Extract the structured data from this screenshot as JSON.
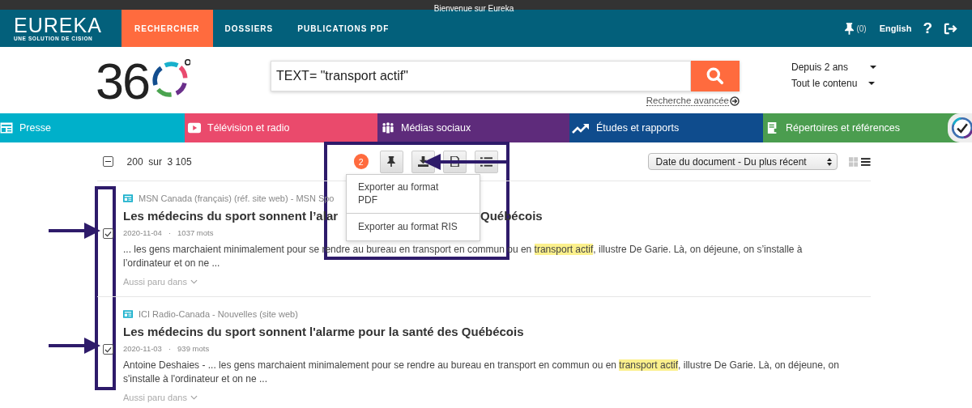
{
  "welcome_bar": {
    "title": "Bienvenue sur Eureka"
  },
  "nav": {
    "logo": "EUREKA",
    "logo_tagline": "UNE SOLUTION DE CISION",
    "tabs": [
      {
        "label": "RECHERCHER",
        "selected": true
      },
      {
        "label": "DOSSIERS",
        "selected": false
      },
      {
        "label": "PUBLICATIONS PDF",
        "selected": false
      }
    ],
    "pinned_count": "(0)",
    "language": "English",
    "help": "?"
  },
  "search": {
    "logo_text": "36",
    "query": "TEXT= \"transport actif\"",
    "advanced_link": "Recherche avancée",
    "filters": [
      {
        "label": "Depuis 2 ans"
      },
      {
        "label": "Tout le contenu"
      }
    ]
  },
  "categories": [
    {
      "label": "Presse",
      "color": "#00b0ca"
    },
    {
      "label": "Télévision et radio",
      "color": "#ea4a6c"
    },
    {
      "label": "Médias sociaux",
      "color": "#5e2b7b"
    },
    {
      "label": "Études et rapports",
      "color": "#0f4c8d"
    },
    {
      "label": "Répertoires et références",
      "color": "#4b9d4f"
    }
  ],
  "results_toolbar": {
    "partially_selected": true,
    "count": "200  sur  3 105",
    "selected_count": "2",
    "sort": "Date du document - Du plus récent"
  },
  "export_menu": {
    "items": [
      "Exporter au format PDF",
      "Exporter au format RIS"
    ]
  },
  "results": [
    {
      "checked": true,
      "source": "MSN Canada (français) (réf. site web) - MSN Spo",
      "title_parts": [
        "Les médecins du sport sonnent l’alar",
        "Québécois"
      ],
      "meta": [
        "2020-11-04",
        "·",
        "1037 mots"
      ],
      "snippet": [
        {
          "text": "... les gens marchaient minimalement pour se rendre au bureau en transport en commun ou en ",
          "highlight": false
        },
        {
          "text": "transport ",
          "highlight": true
        },
        {
          "text": "actif",
          "highlight": true
        },
        {
          "text": ", illustre De Garie. Là, on déjeune, on s’installe à l’ordinateur et on ne ...",
          "highlight": false
        }
      ],
      "also": "Aussi paru dans"
    },
    {
      "checked": true,
      "source": "ICI Radio-Canada - Nouvelles (site web)",
      "title_parts": [
        "Les médecins du sport sonnent l'alarme pour la santé des Québécois"
      ],
      "meta": [
        "2020-11-03",
        "·",
        "939 mots"
      ],
      "snippet": [
        {
          "text": "Antoine Deshaies - ... les gens marchaient minimalement pour se rendre au bureau en transport en commun ou en ",
          "highlight": false
        },
        {
          "text": "transport ",
          "highlight": true
        },
        {
          "text": "actif",
          "highlight": true
        },
        {
          "text": ", illustre De Garie. Là, on déjeune, on s'installe à l'ordinateur et on ne ...",
          "highlight": false
        }
      ],
      "also": "Aussi paru dans"
    }
  ]
}
